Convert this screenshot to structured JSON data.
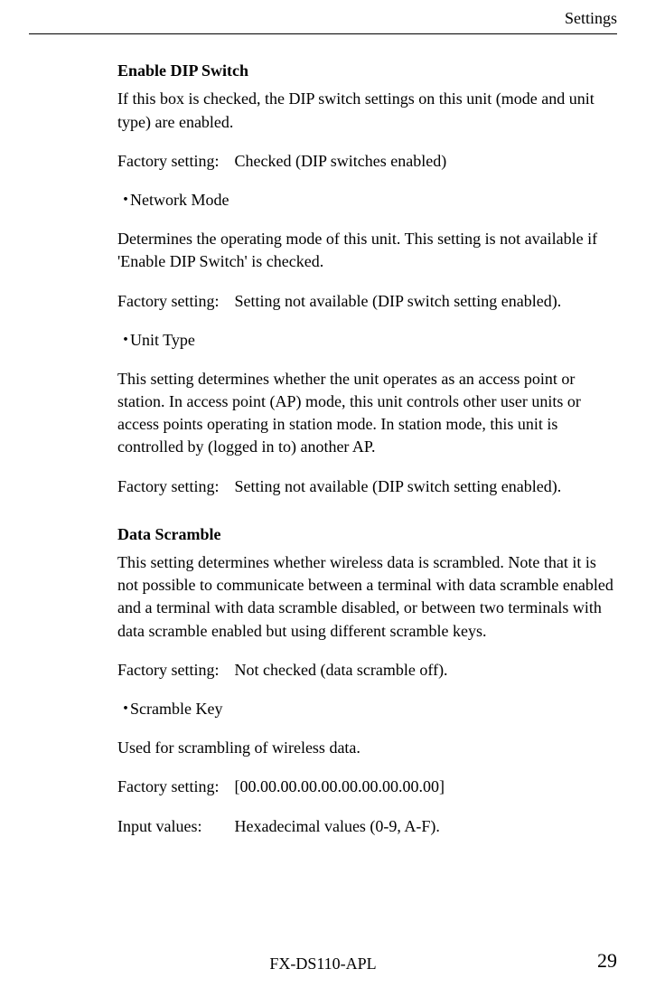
{
  "header": {
    "title": "Settings"
  },
  "sections": {
    "enable_dip": {
      "heading": "Enable DIP Switch",
      "body": "If this box is checked, the DIP switch settings on this unit (mode and unit type) are enabled.",
      "factory_label": "Factory setting:",
      "factory_value": "Checked (DIP switches enabled)"
    },
    "network_mode": {
      "bullet": "・",
      "heading": "Network Mode",
      "body": "Determines the operating mode of this unit.    This setting is not available if 'Enable DIP Switch' is checked.",
      "factory_label": "Factory setting:",
      "factory_value": "Setting not available (DIP switch setting enabled)."
    },
    "unit_type": {
      "bullet": "・",
      "heading": "Unit Type",
      "body": "This setting determines whether the unit operates as an access point or station.    In access point (AP) mode, this unit controls other user units or access points operating in station mode.    In station mode, this unit is controlled by (logged in to) another AP.",
      "factory_label": "Factory setting:",
      "factory_value": "Setting not available (DIP switch setting enabled)."
    },
    "data_scramble": {
      "heading": "Data Scramble",
      "body": "This setting determines whether wireless data is scrambled.    Note that it is not possible to communicate between a terminal with data scramble enabled and a terminal with data scramble disabled, or between two terminals with data scramble enabled but using different scramble keys.",
      "factory_label": "Factory setting:",
      "factory_value": "Not checked (data scramble off)."
    },
    "scramble_key": {
      "bullet": "・",
      "heading": "Scramble Key",
      "body": "Used for scrambling of wireless data.",
      "factory_label": "Factory setting:",
      "factory_value": "[00.00.00.00.00.00.00.00.00.00]",
      "input_label": "Input values:",
      "input_value": "Hexadecimal values (0-9, A-F)."
    }
  },
  "footer": {
    "model": "FX-DS110-APL",
    "page": "29"
  }
}
